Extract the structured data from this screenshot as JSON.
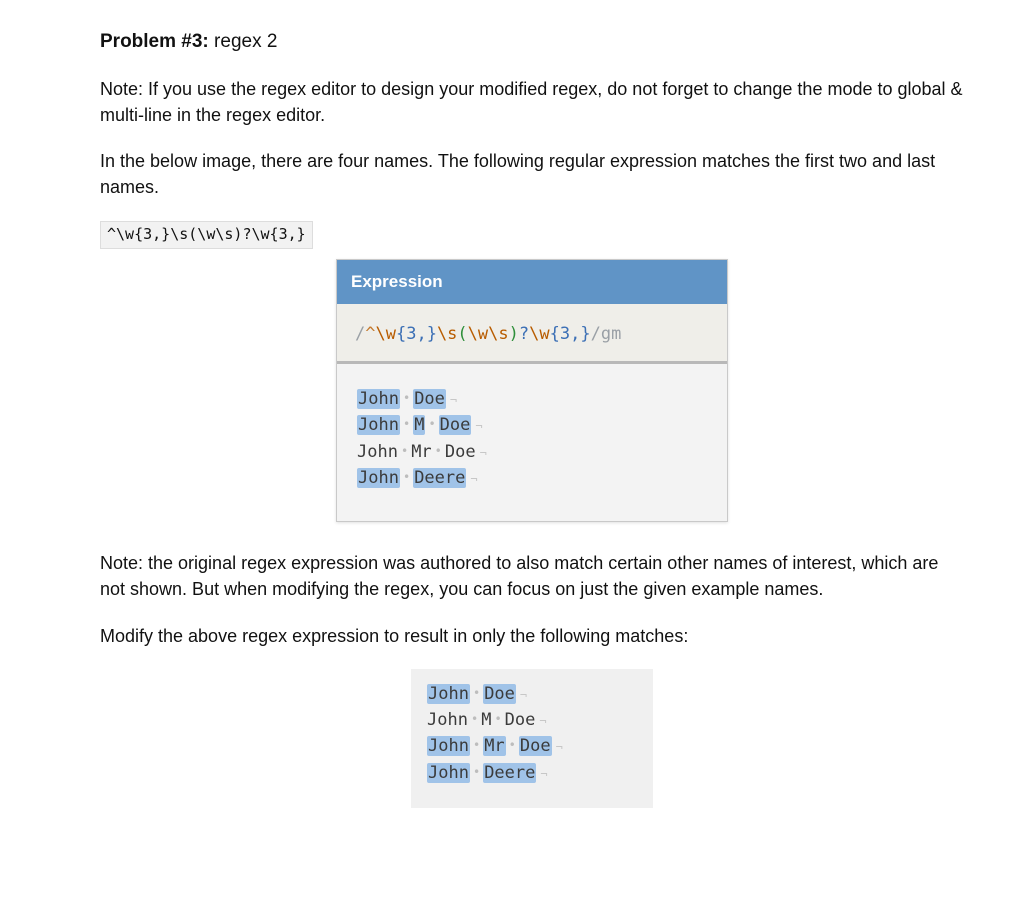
{
  "heading_bold": "Problem #3:",
  "heading_rest": " regex 2",
  "p1": "Note: If you use the regex editor to design your modified regex, do not forget to change the mode to global & multi-line in the regex editor.",
  "p2": "In the below image, there are four names. The following regular expression matches the first two and last names.",
  "regex_inline": "^\\w{3,}\\s(\\w\\s)?\\w{3,}",
  "panel_header": "Expression",
  "rx": {
    "open": "/",
    "caret": "^",
    "e1": "\\w",
    "q1": "{3,}",
    "e2": "\\s",
    "gopen": "(",
    "e3": "\\w",
    "e4": "\\s",
    "gclose": ")",
    "opt": "?",
    "e5": "\\w",
    "q2": "{3,}",
    "close": "/",
    "flags": "gm"
  },
  "names": {
    "john": "John",
    "m": "M",
    "mr": "Mr",
    "doe": "Doe",
    "deere": "Deere"
  },
  "p3": "Note: the original regex expression was authored to also match certain other names of interest, which are not shown. But when modifying the regex, you can focus on just the given example names.",
  "p4": "Modify the above regex expression to result in only the following matches:"
}
